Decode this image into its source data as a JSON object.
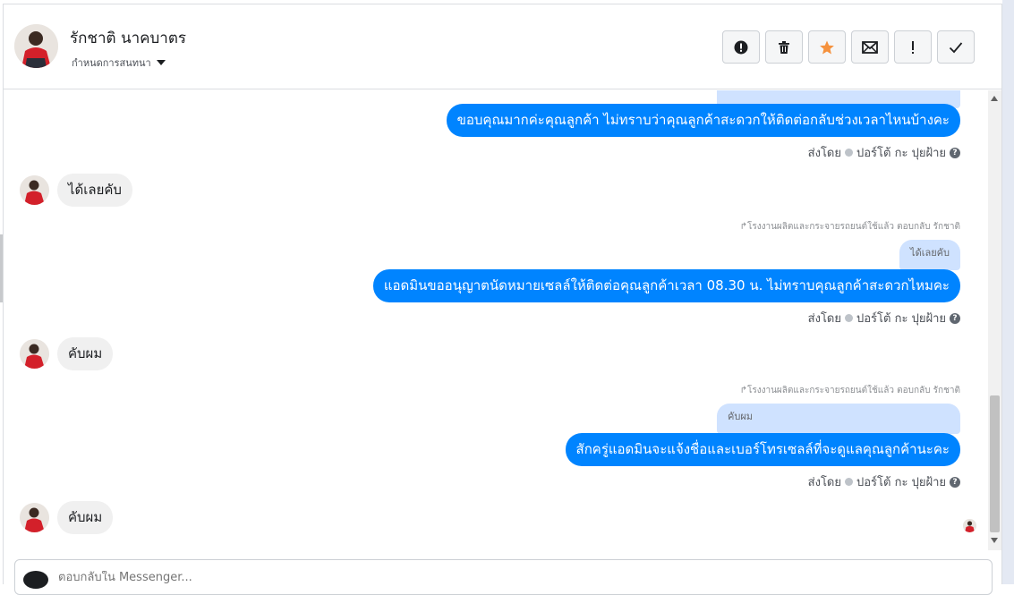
{
  "header": {
    "contact_name": "รักชาติ นาคบาตร",
    "assign_label": "กำหนดการสนทนา"
  },
  "toolbar": {
    "buttons": [
      {
        "name": "report-spam-button",
        "icon": "exclamation-circle-icon"
      },
      {
        "name": "delete-button",
        "icon": "trash-icon"
      },
      {
        "name": "star-button",
        "icon": "star-icon",
        "color": "#f5923e"
      },
      {
        "name": "mark-unread-button",
        "icon": "envelope-icon"
      },
      {
        "name": "follow-up-button",
        "icon": "exclamation-icon"
      },
      {
        "name": "mark-done-button",
        "icon": "checkmark-icon"
      }
    ]
  },
  "messages": {
    "out1": {
      "text": "ขอบคุณมากค่ะคุณลูกค้า ไม่ทราบว่าคุณลูกค้าสะดวกให้ติดต่อกลับช่วงเวลาไหนบ้างคะ",
      "sent_by_label": "ส่งโดย",
      "sender": "ปอร์โต้ กะ ปุยฝ้าย"
    },
    "in1": {
      "text": "ได้เลยคับ"
    },
    "out2": {
      "reply_note": "โรงงานผลิตและกระจายรถยนต์ใช้แล้ว ตอบกลับ รักชาติ",
      "quote": "ได้เลยคับ",
      "text": "แอดมินขออนุญาตนัดหมายเซลล์ให้ติดต่อคุณลูกค้าเวลา 08.30 น. ไม่ทราบคุณลูกค้าสะดวกไหมคะ",
      "sent_by_label": "ส่งโดย",
      "sender": "ปอร์โต้ กะ ปุยฝ้าย"
    },
    "in2": {
      "text": "คับผม"
    },
    "out3": {
      "reply_note": "โรงงานผลิตและกระจายรถยนต์ใช้แล้ว ตอบกลับ รักชาติ",
      "quote": "คับผม",
      "text": "สักครู่แอดมินจะแจ้งชื่อและเบอร์โทรเซลล์ที่จะดูแลคุณลูกค้านะคะ",
      "sent_by_label": "ส่งโดย",
      "sender": "ปอร์โต้ กะ ปุยฝ้าย"
    },
    "in3": {
      "text": "คับผม"
    }
  },
  "composer": {
    "placeholder": "ตอบกลับใน Messenger..."
  },
  "colors": {
    "outgoing_bubble": "#0084ff",
    "incoming_bubble": "#f0f0f0",
    "quote_bubble": "#cfe2ff"
  }
}
